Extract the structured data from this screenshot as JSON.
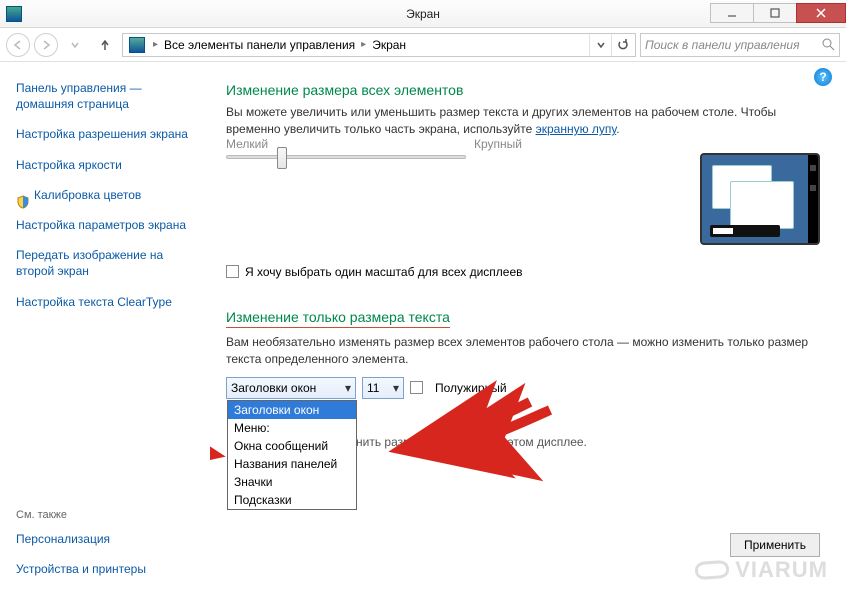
{
  "window": {
    "title": "Экран"
  },
  "titlebar_buttons": {
    "min": "minimize",
    "max": "maximize",
    "close": "close"
  },
  "breadcrumb": {
    "root": "Все элементы панели управления",
    "leaf": "Экран"
  },
  "search": {
    "placeholder": "Поиск в панели управления"
  },
  "sidebar": {
    "items": [
      {
        "label": "Панель управления — домашняя страница"
      },
      {
        "label": "Настройка разрешения экрана"
      },
      {
        "label": "Настройка яркости"
      },
      {
        "label": "Калибровка цветов"
      },
      {
        "label": "Настройка параметров экрана"
      },
      {
        "label": "Передать изображение на второй экран"
      },
      {
        "label": "Настройка текста ClearType"
      }
    ],
    "see_also_label": "См. также",
    "see_also": [
      {
        "label": "Персонализация"
      },
      {
        "label": "Устройства и принтеры"
      }
    ]
  },
  "content": {
    "section1_title": "Изменение размера всех элементов",
    "section1_body_prefix": "Вы можете увеличить или уменьшить размер текста и других элементов на рабочем столе. Чтобы временно увеличить только часть экрана, используйте ",
    "section1_link": "экранную лупу",
    "section1_body_suffix": ".",
    "slider_small": "Мелкий",
    "slider_large": "Крупный",
    "checkbox1_label": "Я хочу выбрать один масштаб для всех дисплеев",
    "section2_title": "Изменение только размера текста",
    "section2_body": "Вам необязательно изменять размер всех элементов рабочего стола — можно изменить только размер текста определенного элемента.",
    "combo_selected": "Заголовки окон",
    "combo_options": [
      "Заголовки окон",
      "Меню:",
      "Окна сообщений",
      "Названия панелей",
      "Значки",
      "Подсказки"
    ],
    "size_value": "11",
    "bold_label": "Полужирный",
    "info_text": "нить размер элементов на этом дисплее.",
    "apply_label": "Применить"
  },
  "watermark": "VIARUM"
}
